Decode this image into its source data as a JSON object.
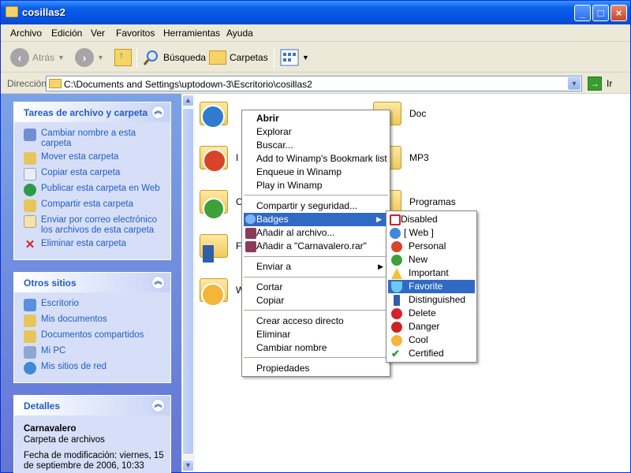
{
  "window": {
    "title": "cosillas2"
  },
  "menubar": [
    "Archivo",
    "Edición",
    "Ver",
    "Favoritos",
    "Herramientas",
    "Ayuda"
  ],
  "toolbar": {
    "back": "Atrás",
    "search": "Búsqueda",
    "folders": "Carpetas"
  },
  "address": {
    "label": "Dirección",
    "path": "C:\\Documents and Settings\\uptodown-3\\Escritorio\\cosillas2",
    "go": "Ir"
  },
  "tasks_panel": {
    "title": "Tareas de archivo y carpeta",
    "items": [
      "Cambiar nombre a esta carpeta",
      "Mover esta carpeta",
      "Copiar esta carpeta",
      "Publicar esta carpeta en Web",
      "Compartir esta carpeta",
      "Enviar por correo electrónico los archivos de esta carpeta",
      "Eliminar esta carpeta"
    ]
  },
  "places_panel": {
    "title": "Otros sitios",
    "items": [
      "Escritorio",
      "Mis documentos",
      "Documentos compartidos",
      "Mi PC",
      "Mis sitios de red"
    ]
  },
  "details_panel": {
    "title": "Detalles",
    "name": "Carnavalero",
    "type": "Carpeta de archivos",
    "modified": "Fecha de modificación: viernes, 15 de septiembre de 2006, 10:33"
  },
  "folders": [
    {
      "label": "Doc"
    },
    {
      "label": "MP3"
    },
    {
      "label": "Programas"
    },
    {
      "label": "I"
    },
    {
      "label": "C"
    },
    {
      "label": "F"
    },
    {
      "label": "W"
    }
  ],
  "context_menu": {
    "items": [
      "Abrir",
      "Explorar",
      "Buscar...",
      "Add to Winamp's Bookmark list",
      "Enqueue in Winamp",
      "Play in Winamp",
      "Compartir y seguridad...",
      "Badges",
      "Añadir al archivo...",
      "Añadir a \"Carnavalero.rar\"",
      "Enviar a",
      "Cortar",
      "Copiar",
      "Crear acceso directo",
      "Eliminar",
      "Cambiar nombre",
      "Propiedades"
    ]
  },
  "badges_submenu": {
    "items": [
      "Disabled",
      "[ Web ]",
      "Personal",
      "New",
      "Important",
      "Favorite",
      "Distinguished",
      "Delete",
      "Danger",
      "Cool",
      "Certified"
    ],
    "highlighted": "Favorite"
  },
  "colors": {
    "titlebar": "#0554e3",
    "highlight": "#316ac5",
    "task_link": "#215dc6"
  }
}
